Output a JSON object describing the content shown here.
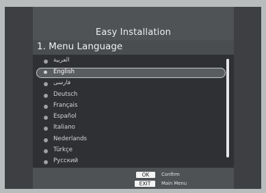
{
  "header": {
    "title": "Easy Installation",
    "subtitle": "1. Menu Language"
  },
  "languages": [
    {
      "label": "العربية",
      "selected": false
    },
    {
      "label": "English",
      "selected": true
    },
    {
      "label": "فارسی",
      "selected": false
    },
    {
      "label": "Deutsch",
      "selected": false
    },
    {
      "label": "Français",
      "selected": false
    },
    {
      "label": "Español",
      "selected": false
    },
    {
      "label": "Italiano",
      "selected": false
    },
    {
      "label": "Nederlands",
      "selected": false
    },
    {
      "label": "Türkçe",
      "selected": false
    },
    {
      "label": "Русский",
      "selected": false
    }
  ],
  "footer": {
    "ok_key": "OK",
    "ok_action": "Confirm",
    "exit_key": "EXIT",
    "exit_action": "Main Menu"
  }
}
